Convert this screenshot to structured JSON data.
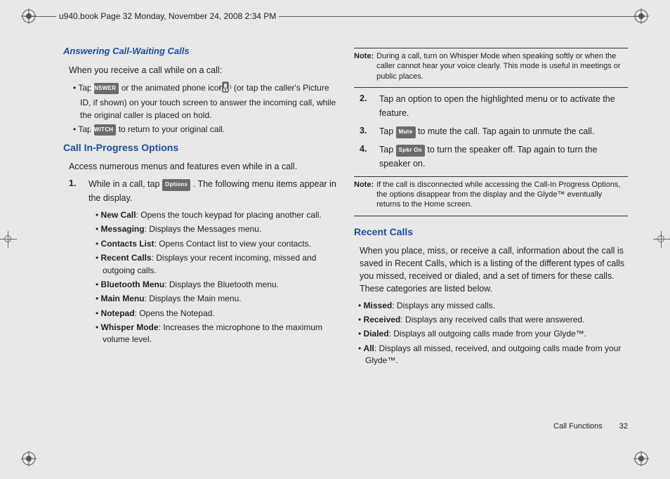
{
  "header_text": "u940.book  Page 32  Monday, November 24, 2008  2:34 PM",
  "left": {
    "h1": "Answering Call-Waiting Calls",
    "p1": "When you receive a call while on a call:",
    "b1_pre": "Tap ",
    "btn_answer": "ANSWER",
    "b1_mid": " or the animated phone icon ",
    "b1_post": " (or tap the caller's Picture ID, if shown) on your touch screen to answer the incoming call, while the original caller is placed on hold.",
    "b2_pre": "Tap ",
    "btn_switch": "SWITCH",
    "b2_post": " to return to your original call.",
    "h2": "Call In-Progress Options",
    "p2": "Access numerous menus and features even while in a call.",
    "step1_num": "1.",
    "step1_pre": "While in a call, tap ",
    "btn_options": "Options",
    "step1_post": ". The following menu items appear in the display.",
    "items": [
      {
        "b": "New Call",
        "t": ": Opens the touch keypad for placing another call."
      },
      {
        "b": "Messaging",
        "t": ": Displays the Messages menu."
      },
      {
        "b": "Contacts List",
        "t": ": Opens Contact list to view your contacts."
      },
      {
        "b": "Recent Calls",
        "t": ": Displays your recent incoming, missed and outgoing calls."
      },
      {
        "b": "Bluetooth Menu",
        "t": ": Displays the Bluetooth menu."
      },
      {
        "b": "Main Menu",
        "t": ": Displays the Main menu."
      },
      {
        "b": "Notepad",
        "t": ": Opens the Notepad."
      },
      {
        "b": "Whisper Mode",
        "t": ": Increases the microphone to the maximum volume level."
      }
    ]
  },
  "right": {
    "note1_label": "Note:",
    "note1_body": "During a call, turn on Whisper Mode when speaking softly or when the caller cannot hear your voice clearly. This mode is useful in meetings or public places.",
    "step2_num": "2.",
    "step2_body": "Tap an option to open the highlighted menu or to activate the feature.",
    "step3_num": "3.",
    "step3_pre": "Tap ",
    "btn_mute": "Mute",
    "step3_post": " to mute the call. Tap again to unmute the call.",
    "step4_num": "4.",
    "step4_pre": "Tap ",
    "btn_spkr": "Spkr On",
    "step4_post": " to turn the speaker off. Tap again to turn the speaker on.",
    "note2_label": "Note:",
    "note2_body": "If the call is disconnected while accessing the Call-In Progress Options, the options disappear from the display and the Glyde™ eventually returns to the Home screen.",
    "h3": "Recent Calls",
    "p3": "When you place, miss, or receive a call, information about the call is saved in Recent Calls, which is a listing of the different types of calls you missed, received or dialed, and a set of timers for these calls. These categories are listed below.",
    "rc": [
      {
        "b": "Missed",
        "t": ": Displays any missed calls."
      },
      {
        "b": "Received",
        "t": ": Displays any received calls that were answered."
      },
      {
        "b": "Dialed",
        "t": ": Displays all outgoing calls made from your Glyde™."
      },
      {
        "b": "All",
        "t": ": Displays all missed, received, and outgoing calls made from your Glyde™."
      }
    ]
  },
  "footer_section": "Call Functions",
  "footer_page": "32"
}
